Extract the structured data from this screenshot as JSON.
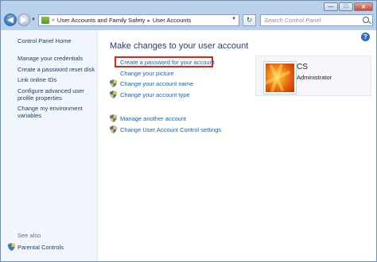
{
  "window": {
    "minimize_icon": "minimize-icon",
    "maximize_icon": "maximize-icon",
    "close_icon": "close-icon"
  },
  "address": {
    "crumbs": [
      "User Accounts and Family Safety",
      "User Accounts"
    ],
    "crumb_separator": "▸",
    "prefix": "«"
  },
  "search": {
    "placeholder": "Search Control Panel"
  },
  "sidebar": {
    "items": [
      {
        "label": "Control Panel Home"
      },
      {
        "label": "Manage your credentials"
      },
      {
        "label": "Create a password reset disk"
      },
      {
        "label": "Link online IDs"
      },
      {
        "label": "Configure advanced user profile properties"
      },
      {
        "label": "Change my environment variables"
      }
    ],
    "see_also": "See also",
    "parental_controls": "Parental Controls"
  },
  "main": {
    "title": "Make changes to your user account",
    "tasks": [
      {
        "label": "Create a password for your account",
        "shield": false
      },
      {
        "label": "Change your picture",
        "shield": false
      },
      {
        "label": "Change your account name",
        "shield": true
      },
      {
        "label": "Change your account type",
        "shield": true
      }
    ],
    "other_tasks": [
      {
        "label": "Manage another account",
        "shield": true
      },
      {
        "label": "Change User Account Control settings",
        "shield": true
      }
    ],
    "highlight_color": "#e2231a"
  },
  "account": {
    "name": "CS",
    "role": "Administrator"
  },
  "help_label": "?"
}
